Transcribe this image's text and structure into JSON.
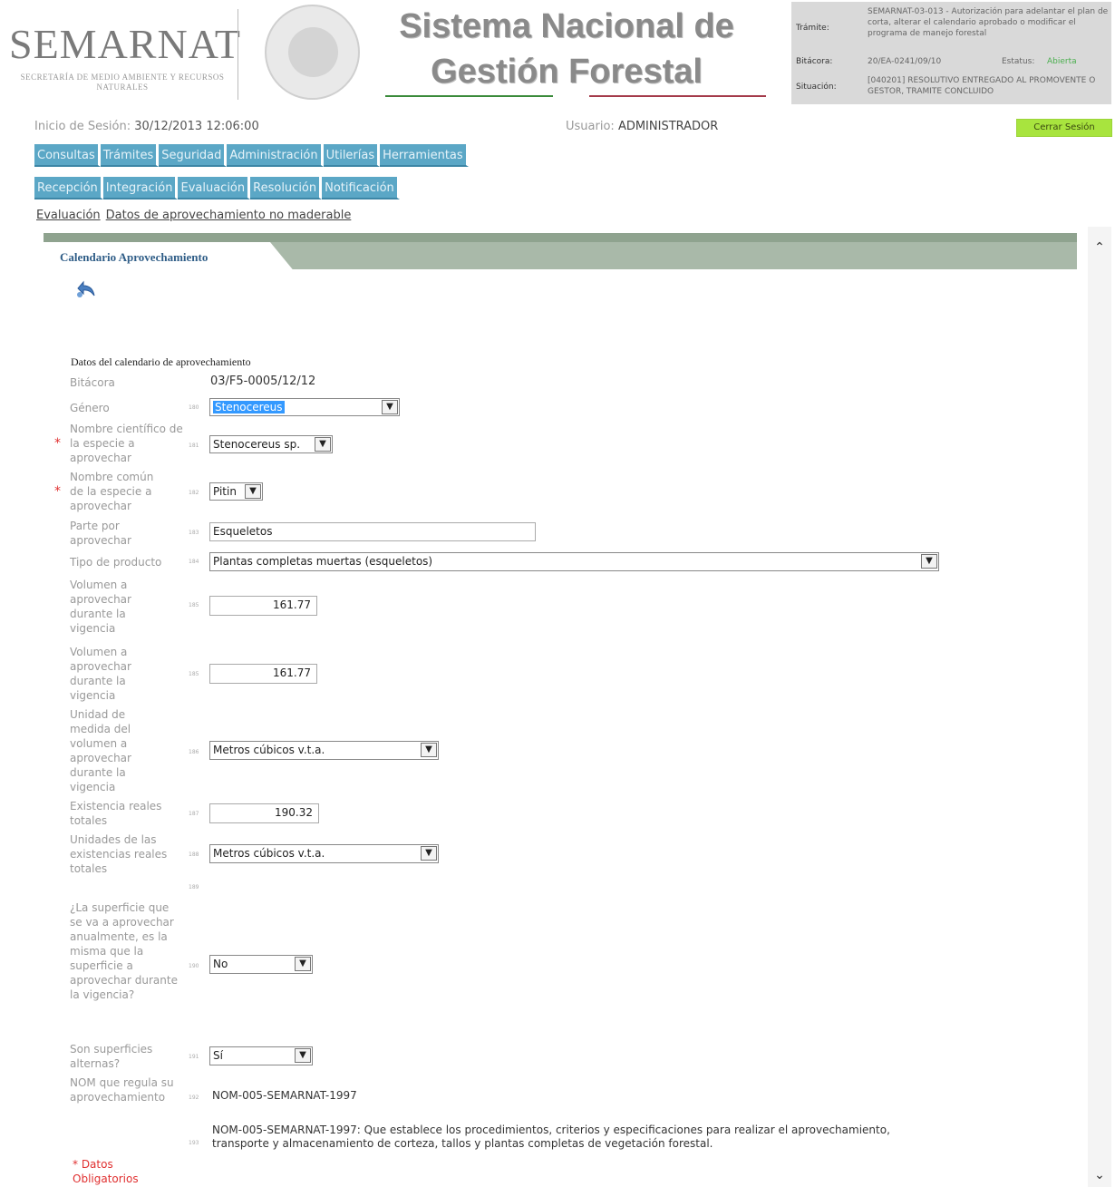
{
  "header": {
    "logo_text": "SEMARNAT",
    "logo_subtitle": "SECRETARÍA DE MEDIO AMBIENTE Y RECURSOS NATURALES",
    "system_title_line1": "Sistema Nacional de",
    "system_title_line2": "Gestión Forestal"
  },
  "info": {
    "tramite_label": "Trámite:",
    "tramite_value": "SEMARNAT-03-013 - Autorización para adelantar el plan de corta, alterar el calendario aprobado o modificar el programa de manejo forestal",
    "bitacora_label": "Bitácora:",
    "bitacora_value": "20/EA-0241/09/10",
    "estatus_label": "Estatus:",
    "estatus_value": "Abierta",
    "situacion_label": "Situación:",
    "situacion_value": "[040201] RESOLUTIVO ENTREGADO AL PROMOVENTE O GESTOR, TRAMITE CONCLUIDO"
  },
  "session": {
    "login_label": "Inicio de Sesión:",
    "login_value": "30/12/2013 12:06:00",
    "user_label": "Usuario:",
    "user_value": "ADMINISTRADOR",
    "logout_label": "Cerrar Sesión"
  },
  "menu_main": [
    "Consultas",
    "Trámites",
    "Seguridad",
    "Administración",
    "Utilerías",
    "Herramientas"
  ],
  "menu_sub": [
    "Recepción",
    "Integración",
    "Evaluación",
    "Resolución",
    "Notificación"
  ],
  "breadcrumb": [
    "Evaluación",
    "Datos de aprovechamiento no maderable"
  ],
  "tab_title": "Calendario Aprovechamiento",
  "form": {
    "section_title": "Datos del calendario de aprovechamiento",
    "bitacora": {
      "label": "Bitácora",
      "value": "03/F5-0005/12/12"
    },
    "genero": {
      "label": "Género",
      "num": "180",
      "value": "Stenocereus"
    },
    "nombre_cientifico": {
      "label": "Nombre científico de la especie a aprovechar",
      "num": "181",
      "value": "Stenocereus sp."
    },
    "nombre_comun": {
      "label": "Nombre común de la especie a aprovechar",
      "num": "182",
      "value": "Pitin"
    },
    "parte": {
      "label": "Parte por aprovechar",
      "num": "183",
      "value": "Esqueletos"
    },
    "tipo_producto": {
      "label": "Tipo de producto",
      "num": "184",
      "value": "Plantas completas muertas (esqueletos)"
    },
    "volumen1": {
      "label": "Volumen a aprovechar durante la vigencia",
      "num": "185",
      "value": "161.77"
    },
    "volumen2": {
      "label": "Volumen a aprovechar durante la vigencia",
      "num": "185",
      "value": "161.77"
    },
    "unidad_volumen": {
      "label": "Unidad de medida del volumen a aprovechar durante la vigencia",
      "num": "186",
      "value": "Metros cúbicos v.t.a."
    },
    "existencia": {
      "label": "Existencia reales totales",
      "num": "187",
      "value": "190.32"
    },
    "unidades_existencias": {
      "label": "Unidades de las existencias reales totales",
      "num": "188",
      "value": "Metros cúbicos v.t.a."
    },
    "blank_num": "189",
    "superficie": {
      "label": "¿La superficie que se va a aprovechar anualmente, es la misma que la superficie a aprovechar durante la vigencia?",
      "num": "190",
      "value": "No"
    },
    "alternas": {
      "label": "Son superficies alternas?",
      "num": "191",
      "value": "Sí"
    },
    "nom": {
      "label": "NOM que regula su aprovechamiento",
      "num": "192",
      "value": "NOM-005-SEMARNAT-1997"
    },
    "nom_desc": {
      "num": "193",
      "value": "NOM-005-SEMARNAT-1997: Que establece los procedimientos, criterios y especificaciones para realizar el aprovechamiento, transporte y almacenamiento de corteza, tallos y plantas completas de vegetación forestal."
    },
    "required_mark": "*",
    "required_note": "* Datos Obligatorios"
  }
}
